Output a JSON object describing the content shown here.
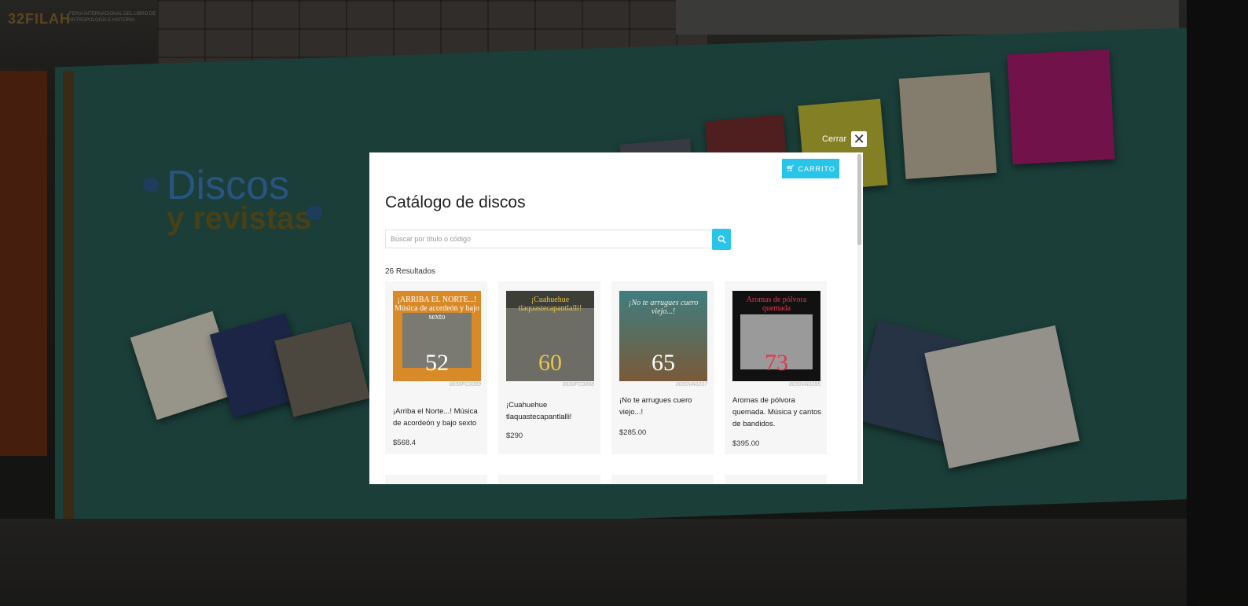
{
  "booth": {
    "logo_text": "32FILAH",
    "logo_subtext": "FERIA INTERNACIONAL DEL LIBRO DE ANTROPOLOGÍA E HISTORIA",
    "title_line1": "Discos",
    "title_line2": "y revistas"
  },
  "modal": {
    "close_label": "Cerrar",
    "cart_label": "CARRITO",
    "title": "Catálogo de discos",
    "search_placeholder": "Buscar por título o código",
    "results_count": "26 Resultados",
    "products": [
      {
        "code": "0030FC0089",
        "title": "¡Arriba el Norte...! Música de acordeón y bajo sexto",
        "price": "$568.4",
        "cover_text": "¡ARRIBA EL NORTE...! Música de acordeón y bajo sexto",
        "cover_number": "52"
      },
      {
        "code": "0030FC0068",
        "title": "¡Cuahuehue tlaquastecapantlalli!",
        "price": "$290",
        "cover_text": "¡Cuahuehue tlaquastecapantlalli!",
        "cover_number": "60"
      },
      {
        "code": "0030VA0207",
        "title": "¡No te arrugues cuero viejo...!",
        "price": "$285.00",
        "cover_text": "¡No te arrugues cuero viejo...!",
        "cover_number": "65"
      },
      {
        "code": "0030VA0285",
        "title": "Aromas de pólvora quemada. Música y cantos de bandidos.",
        "price": "$395.00",
        "cover_text": "Aromas de pólvora quemada",
        "cover_number": "73"
      }
    ]
  },
  "colors": {
    "accent": "#29c4ea",
    "wall": "#2a6058",
    "frame": "#5b4322"
  }
}
